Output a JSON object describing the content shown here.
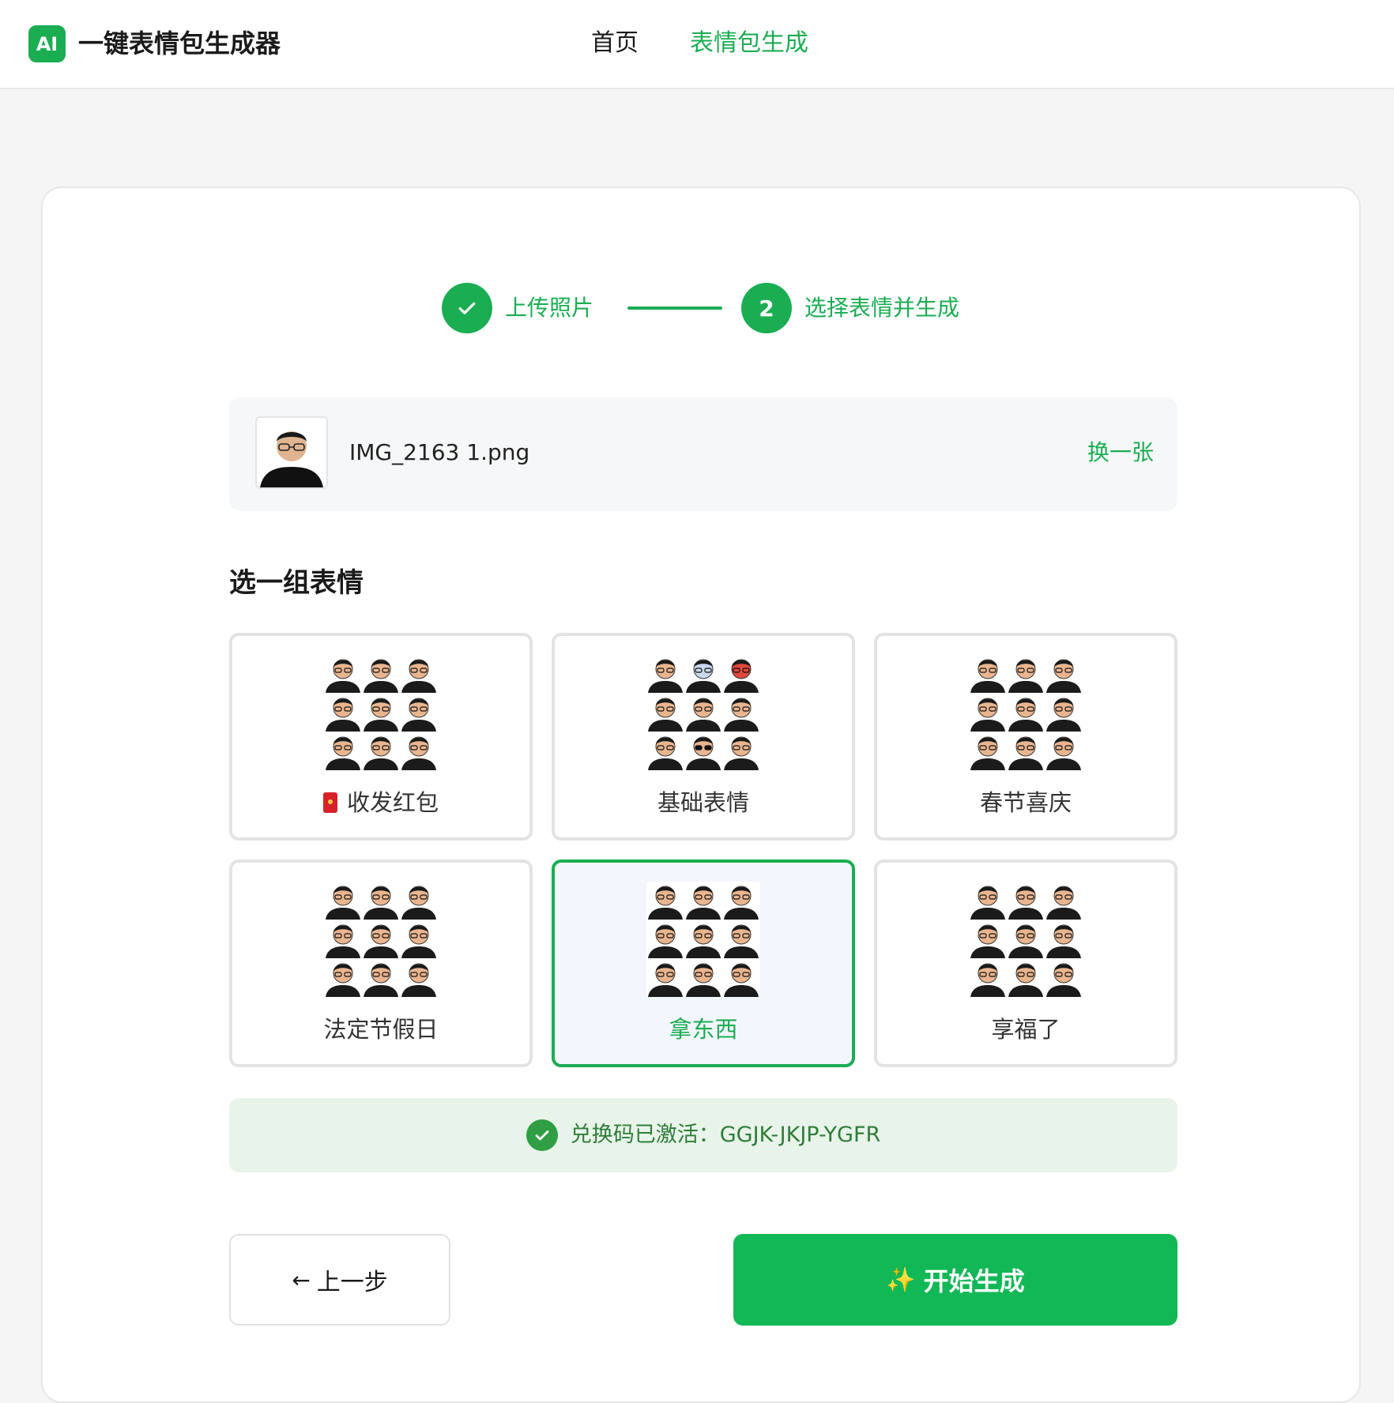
{
  "header": {
    "logo_text": "AI",
    "app_title": "一键表情包生成器",
    "nav": [
      {
        "label": "首页",
        "active": false
      },
      {
        "label": "表情包生成",
        "active": true
      }
    ]
  },
  "steps": [
    {
      "index": "",
      "label": "上传照片",
      "status": "done",
      "icon": "check-icon"
    },
    {
      "index": "2",
      "label": "选择表情并生成",
      "status": "current"
    }
  ],
  "upload": {
    "file_name": "IMG_2163 1.png",
    "swap_label": "换一张"
  },
  "section_title": "选一组表情",
  "options": [
    {
      "label": "收发红包",
      "icon": "red-envelope-icon",
      "selected": false
    },
    {
      "label": "基础表情",
      "selected": false
    },
    {
      "label": "春节喜庆",
      "selected": false
    },
    {
      "label": "法定节假日",
      "selected": false
    },
    {
      "label": "拿东西",
      "selected": true
    },
    {
      "label": "享福了",
      "selected": false
    }
  ],
  "redeem": {
    "text": "兑换码已激活：GGJK-JKJP-YGFR"
  },
  "actions": {
    "back_label": "上一步",
    "start_label": "开始生成",
    "start_icon": "sparkle-icon"
  },
  "colors": {
    "accent": "#1aad52",
    "button": "#12b856",
    "success_bg": "#e8f4e9",
    "success_text": "#2f7d3a",
    "selected_bg": "#f4f6fd"
  }
}
